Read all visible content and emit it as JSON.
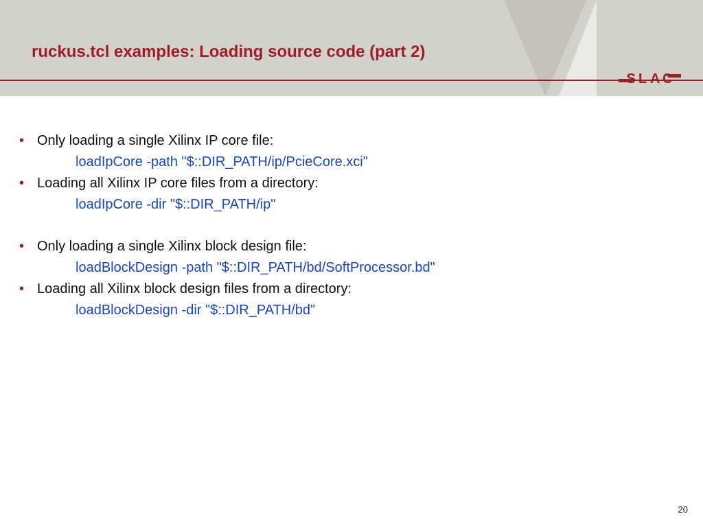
{
  "title": "ruckus.tcl examples: Loading source code (part 2)",
  "logo_text": "SLAC",
  "bullets": {
    "b1": "Only loading a single Xilinx IP core file:",
    "c1": "loadIpCore -path \"$::DIR_PATH/ip/PcieCore.xci\"",
    "b2": "Loading all Xilinx IP core files from a directory:",
    "c2": "loadIpCore -dir \"$::DIR_PATH/ip\"",
    "b3": "Only loading a single Xilinx block design file:",
    "c3": "loadBlockDesign -path \"$::DIR_PATH/bd/SoftProcessor.bd\"",
    "b4": "Loading all Xilinx block design files from a directory:",
    "c4": "loadBlockDesign -dir \"$::DIR_PATH/bd\""
  },
  "page_number": "20"
}
